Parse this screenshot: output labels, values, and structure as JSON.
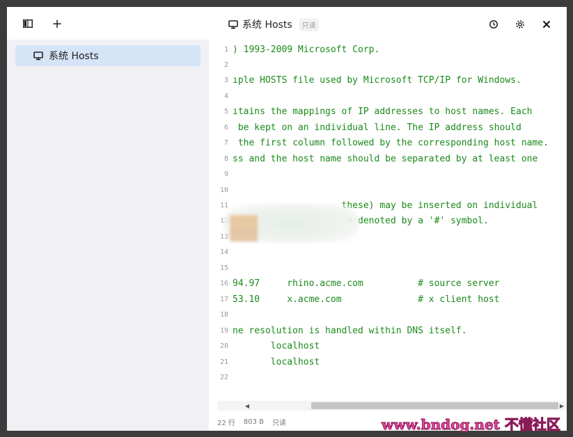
{
  "toolbar": {
    "add_label": "+",
    "sidebar_toggle_icon": "sidebar-layout-icon"
  },
  "header": {
    "title": "系统 Hosts",
    "badge": "只读"
  },
  "sidebar": {
    "items": [
      {
        "label": "系统 Hosts",
        "icon": "monitor-icon"
      }
    ]
  },
  "editor": {
    "lines": [
      {
        "n": "1",
        "text": ") 1993-2009 Microsoft Corp."
      },
      {
        "n": "2",
        "text": ""
      },
      {
        "n": "3",
        "text": "ıple HOSTS file used by Microsoft TCP/IP for Windows."
      },
      {
        "n": "4",
        "text": ""
      },
      {
        "n": "5",
        "text": "ıtains the mappings of IP addresses to host names. Each"
      },
      {
        "n": "6",
        "text": " be kept on an individual line. The IP address should"
      },
      {
        "n": "7",
        "text": " the first column followed by the corresponding host name."
      },
      {
        "n": "8",
        "text": "ss and the host name should be separated by at least one"
      },
      {
        "n": "9",
        "text": ""
      },
      {
        "n": "10",
        "text": ""
      },
      {
        "n": "11",
        "text": "                    these) may be inserted on individual"
      },
      {
        "n": "12",
        "text": "                     e denoted by a '#' symbol."
      },
      {
        "n": "13",
        "text": ""
      },
      {
        "n": "14",
        "text": ""
      },
      {
        "n": "15",
        "text": ""
      },
      {
        "n": "16",
        "text": "94.97     rhino.acme.com          # source server"
      },
      {
        "n": "17",
        "text": "53.10     x.acme.com              # x client host"
      },
      {
        "n": "18",
        "text": ""
      },
      {
        "n": "19",
        "text": "ne resolution is handled within DNS itself."
      },
      {
        "n": "20",
        "text": "       localhost"
      },
      {
        "n": "21",
        "text": "       localhost"
      },
      {
        "n": "22",
        "text": ""
      }
    ]
  },
  "status": {
    "lines": "22 行",
    "size": "803 B",
    "mode": "只读"
  },
  "watermark": "www.bndog.net 不懂社区",
  "colors": {
    "code": "#1a8a1a",
    "sidebar_bg": "#f0f0f5",
    "selected_item": "#d6e4f7"
  }
}
